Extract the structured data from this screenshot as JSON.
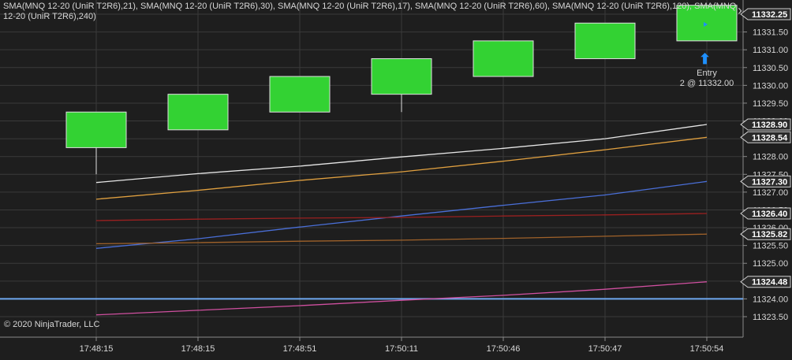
{
  "indicator_label": "SMA(MNQ 12-20 (UniR T2R6),21), SMA(MNQ 12-20 (UniR T2R6),30), SMA(MNQ 12-20 (UniR T2R6),17), SMA(MNQ 12-20 (UniR T2R6),60), SMA(MNQ 12-20 (UniR T2R6),120), SMA(MNQ 12-20 (UniR T2R6),240)",
  "copyright": "© 2020 NinjaTrader, LLC",
  "entry": {
    "title": "Entry",
    "detail": "2 @ 11332.00",
    "arrow_icon": "up-arrow-icon"
  },
  "nav_icon": "chevron-right-icon",
  "colors": {
    "background": "#1e1e1e",
    "grid": "#3a3a3a",
    "candle_fill": "#33d233",
    "candle_border": "#e0e0e0",
    "price_line": "#6fa8f0",
    "axis_text": "#d7d7d7",
    "marker": "#1e90ff"
  },
  "chart_data": {
    "type": "candlestick",
    "instrument": "MNQ 12-20 (UniR T2R6)",
    "x_categories": [
      "17:48:15",
      "17:48:15",
      "17:48:51",
      "17:50:11",
      "17:50:46",
      "17:50:47",
      "17:50:54"
    ],
    "ylim": [
      11323.25,
      11332.35
    ],
    "y_ticks": [
      "11323.50",
      "11324.00",
      "11324.50",
      "11325.00",
      "11325.50",
      "11326.00",
      "11326.50",
      "11327.00",
      "11327.50",
      "11328.00",
      "11328.50",
      "11329.00",
      "11329.50",
      "11330.00",
      "11330.50",
      "11331.00",
      "11331.50",
      "11332.00"
    ],
    "candles": [
      {
        "open": 11328.25,
        "close": 11329.25,
        "high": 11329.25,
        "low": 11327.5
      },
      {
        "open": 11328.75,
        "close": 11329.75,
        "high": 11329.75,
        "low": 11328.75
      },
      {
        "open": 11329.25,
        "close": 11330.25,
        "high": 11330.25,
        "low": 11329.25
      },
      {
        "open": 11329.75,
        "close": 11330.75,
        "high": 11330.75,
        "low": 11329.25
      },
      {
        "open": 11330.25,
        "close": 11331.25,
        "high": 11331.25,
        "low": 11330.25
      },
      {
        "open": 11330.75,
        "close": 11331.75,
        "high": 11331.75,
        "low": 11330.75
      },
      {
        "open": 11331.25,
        "close": 11332.25,
        "high": 11332.25,
        "low": 11331.25
      }
    ],
    "series": [
      {
        "color": "#e6e6e6",
        "values": [
          11327.27,
          11327.52,
          11327.73,
          11327.99,
          11328.23,
          11328.5,
          11328.9
        ]
      },
      {
        "color": "#e0a040",
        "values": [
          11326.8,
          11327.05,
          11327.33,
          11327.57,
          11327.87,
          11328.19,
          11328.54
        ]
      },
      {
        "color": "#4a6fd8",
        "values": [
          11325.42,
          11325.69,
          11326.02,
          11326.33,
          11326.63,
          11326.92,
          11327.3
        ]
      },
      {
        "color": "#9a2020",
        "values": [
          11326.2,
          11326.24,
          11326.27,
          11326.29,
          11326.33,
          11326.36,
          11326.4
        ]
      },
      {
        "color": "#a0622a",
        "values": [
          11325.55,
          11325.58,
          11325.62,
          11325.65,
          11325.7,
          11325.76,
          11325.82
        ]
      },
      {
        "color": "#d050a0",
        "values": [
          11323.55,
          11323.68,
          11323.81,
          11323.96,
          11324.1,
          11324.27,
          11324.48
        ]
      }
    ],
    "price_line": 11324.0,
    "price_labels": [
      "11332.25",
      "11328.90",
      "11328.54",
      "11327.30",
      "11326.40",
      "11325.82",
      "11324.48"
    ],
    "grid": true
  }
}
